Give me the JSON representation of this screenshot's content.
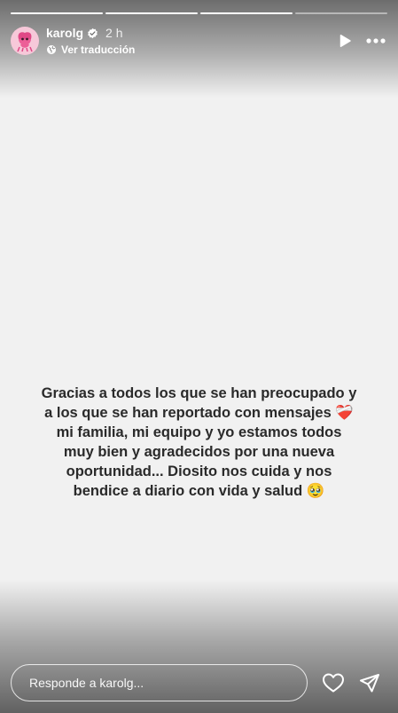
{
  "progress": {
    "total": 4,
    "completed": 3
  },
  "header": {
    "username": "karolg",
    "time": "2 h",
    "translate_label": "Ver traducción"
  },
  "story": {
    "text": "Gracias a todos los que se han preocupado y\na los que se han reportado con mensajes ❤️‍🩹\nmi familia, mi equipo y yo estamos todos\nmuy bien y agradecidos por una nueva\noportunidad... Diosito nos cuida y nos\nbendice a diario con vida y salud 🥹"
  },
  "reply": {
    "placeholder": "Responde a karolg..."
  },
  "icons": {
    "avatar": "avatar",
    "verified": "verified-badge-icon",
    "translate": "globe-icon",
    "play": "play-icon",
    "more": "more-icon",
    "like": "heart-icon",
    "share": "paper-plane-icon"
  },
  "colors": {
    "background": "#f1f1f1",
    "text": "#2a2a2a",
    "avatar": "#f7c8d9"
  }
}
